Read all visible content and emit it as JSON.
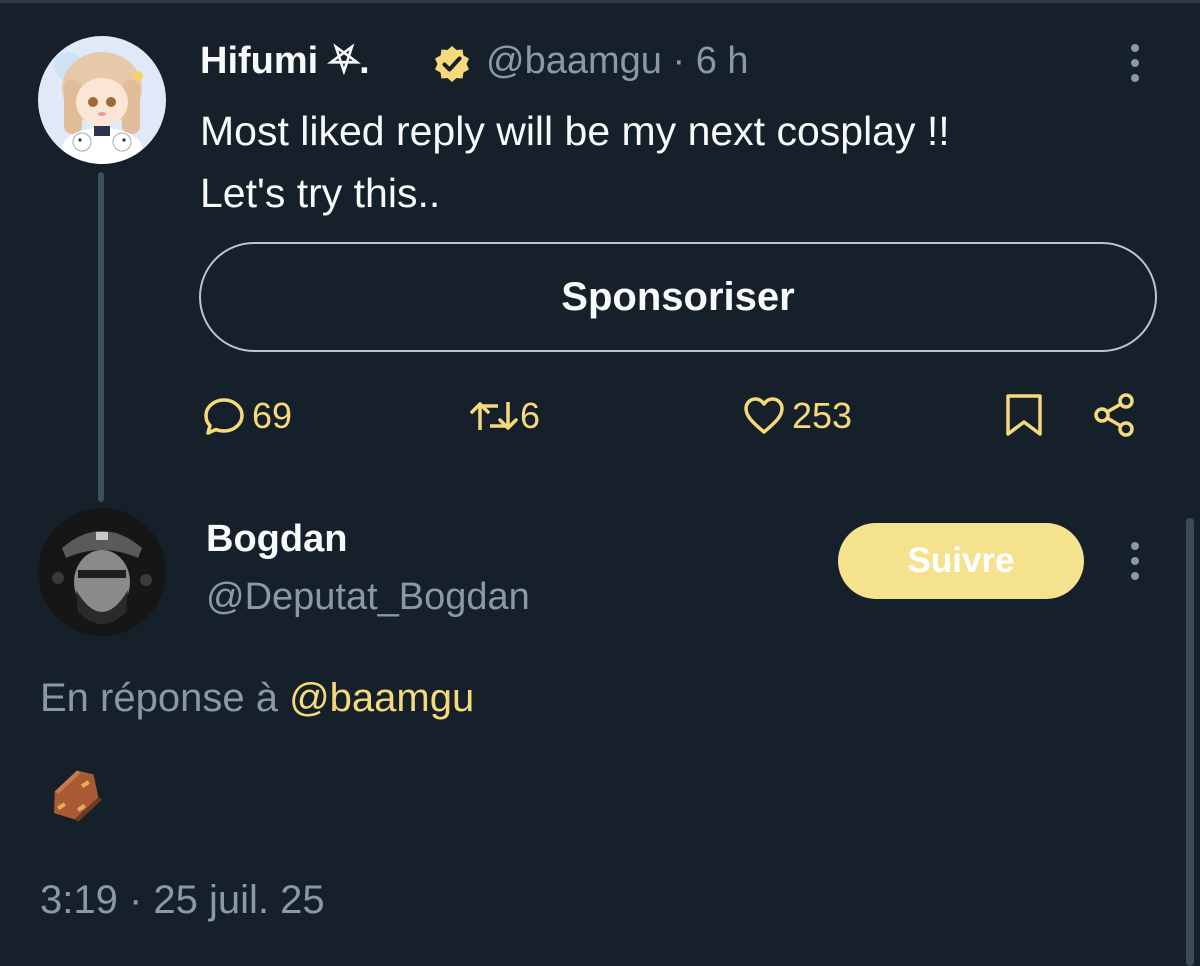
{
  "tweet": {
    "author": {
      "name": "Hifumi",
      "name_decoration": "⛧.",
      "handle": "@baamgu",
      "separator": "·",
      "time": "6 h",
      "verified": true
    },
    "text_lines": [
      "Most liked reply will be my next cosplay !!",
      "Let's try this.."
    ],
    "sponsor_label": "Sponsoriser",
    "actions": {
      "replies": "69",
      "reposts": "6",
      "likes": "253"
    }
  },
  "reply": {
    "author": {
      "name": "Bogdan",
      "handle": "@Deputat_Bogdan"
    },
    "follow_label": "Suivre",
    "reply_to_prefix": "En réponse à",
    "reply_to_mention": "@baamgu",
    "content_emoji": "coffin-emoji",
    "timestamp": "3:19 · 25 juil. 25"
  },
  "icons": {
    "verified": "verified-badge-icon",
    "reply": "reply-icon",
    "repost": "repost-icon",
    "like": "heart-icon",
    "bookmark": "bookmark-icon",
    "share": "share-icon",
    "more": "more-options-icon"
  },
  "colors": {
    "background": "#15202b",
    "accent": "#f5d97a",
    "follow_button": "#f5e28f",
    "muted_text": "#8b98a5",
    "primary_text": "#f7f9f9"
  }
}
